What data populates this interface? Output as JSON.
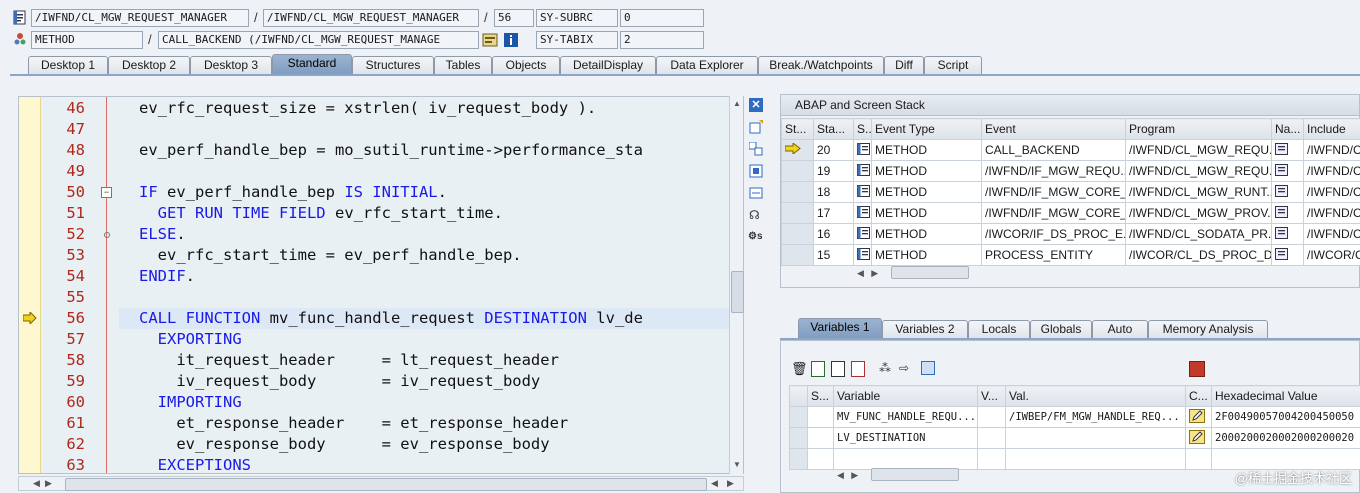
{
  "header": {
    "row1": {
      "field1": "/IWFND/CL_MGW_REQUEST_MANAGER",
      "field2": "/IWFND/CL_MGW_REQUEST_MANAGER",
      "line": "56",
      "sysvar": "SY-SUBRC",
      "sysval": "0"
    },
    "row2": {
      "type": "METHOD",
      "name": "CALL_BACKEND (/IWFND/CL_MGW_REQUEST_MANAGE",
      "sysvar": "SY-TABIX",
      "sysval": "2"
    },
    "sep": "/"
  },
  "tabs": [
    "Desktop 1",
    "Desktop 2",
    "Desktop 3",
    "Standard",
    "Structures",
    "Tables",
    "Objects",
    "DetailDisplay",
    "Data Explorer",
    "Break./Watchpoints",
    "Diff",
    "Script"
  ],
  "active_tab": "Standard",
  "editor": {
    "lines": [
      {
        "n": "46",
        "t": "ev_rfc_request_size = xstrlen( iv_request_body )."
      },
      {
        "n": "47",
        "t": ""
      },
      {
        "n": "48",
        "t": "ev_perf_handle_bep = mo_sutil_runtime->performance_sta"
      },
      {
        "n": "49",
        "t": ""
      },
      {
        "n": "50",
        "t": "IF ev_perf_handle_bep IS INITIAL."
      },
      {
        "n": "51",
        "t": "  GET RUN TIME FIELD ev_rfc_start_time."
      },
      {
        "n": "52",
        "t": "ELSE."
      },
      {
        "n": "53",
        "t": "  ev_rfc_start_time = ev_perf_handle_bep."
      },
      {
        "n": "54",
        "t": "ENDIF."
      },
      {
        "n": "55",
        "t": ""
      },
      {
        "n": "56",
        "t": "CALL FUNCTION mv_func_handle_request DESTINATION lv_de"
      },
      {
        "n": "57",
        "t": "  EXPORTING"
      },
      {
        "n": "58",
        "t": "    it_request_header     = lt_request_header"
      },
      {
        "n": "59",
        "t": "    iv_request_body       = iv_request_body"
      },
      {
        "n": "60",
        "t": "  IMPORTING"
      },
      {
        "n": "61",
        "t": "    et_response_header    = et_response_header"
      },
      {
        "n": "62",
        "t": "    ev_response_body      = ev_response_body"
      },
      {
        "n": "63",
        "t": "  EXCEPTIONS"
      }
    ],
    "current_line": "56"
  },
  "stack": {
    "title": "ABAP and Screen Stack",
    "columns": [
      "St...",
      "Sta...",
      "S...",
      "Event Type",
      "Event",
      "Program",
      "Na...",
      "Include"
    ],
    "rows": [
      {
        "level": "20",
        "type": "METHOD",
        "event": "CALL_BACKEND",
        "program": "/IWFND/CL_MGW_REQU...",
        "include": "/IWFND/C",
        "current": true
      },
      {
        "level": "19",
        "type": "METHOD",
        "event": "/IWFND/IF_MGW_REQU...",
        "program": "/IWFND/CL_MGW_REQU...",
        "include": "/IWFND/C",
        "current": false
      },
      {
        "level": "18",
        "type": "METHOD",
        "event": "/IWFND/IF_MGW_CORE_...",
        "program": "/IWFND/CL_MGW_RUNT...",
        "include": "/IWFND/C",
        "current": false
      },
      {
        "level": "17",
        "type": "METHOD",
        "event": "/IWFND/IF_MGW_CORE_...",
        "program": "/IWFND/CL_MGW_PROV...",
        "include": "/IWFND/C",
        "current": false
      },
      {
        "level": "16",
        "type": "METHOD",
        "event": "/IWCOR/IF_DS_PROC_E...",
        "program": "/IWFND/CL_SODATA_PR...",
        "include": "/IWFND/C",
        "current": false
      },
      {
        "level": "15",
        "type": "METHOD",
        "event": "PROCESS_ENTITY",
        "program": "/IWCOR/CL_DS_PROC_D...",
        "include": "/IWCOR/C",
        "current": false
      }
    ]
  },
  "vartabs": [
    "Variables 1",
    "Variables 2",
    "Locals",
    "Globals",
    "Auto",
    "Memory Analysis"
  ],
  "active_vartab": "Variables 1",
  "vars": {
    "columns": [
      "S...",
      "Variable",
      "V...",
      "Val.",
      "C...",
      "Hexadecimal Value"
    ],
    "rows": [
      {
        "name": "MV_FUNC_HANDLE_REQU...",
        "val": "/IWBEP/FM_MGW_HANDLE_REQ...",
        "hex": "2F00490057004200450050"
      },
      {
        "name": "LV_DESTINATION",
        "val": "",
        "hex": "2000200020002000200020"
      }
    ]
  },
  "watermark": "@稀土掘金技术社区",
  "colors": {
    "keyword": "#1a1ae6",
    "linenum": "#b0271b",
    "activeTab": "#8aa6c8"
  }
}
